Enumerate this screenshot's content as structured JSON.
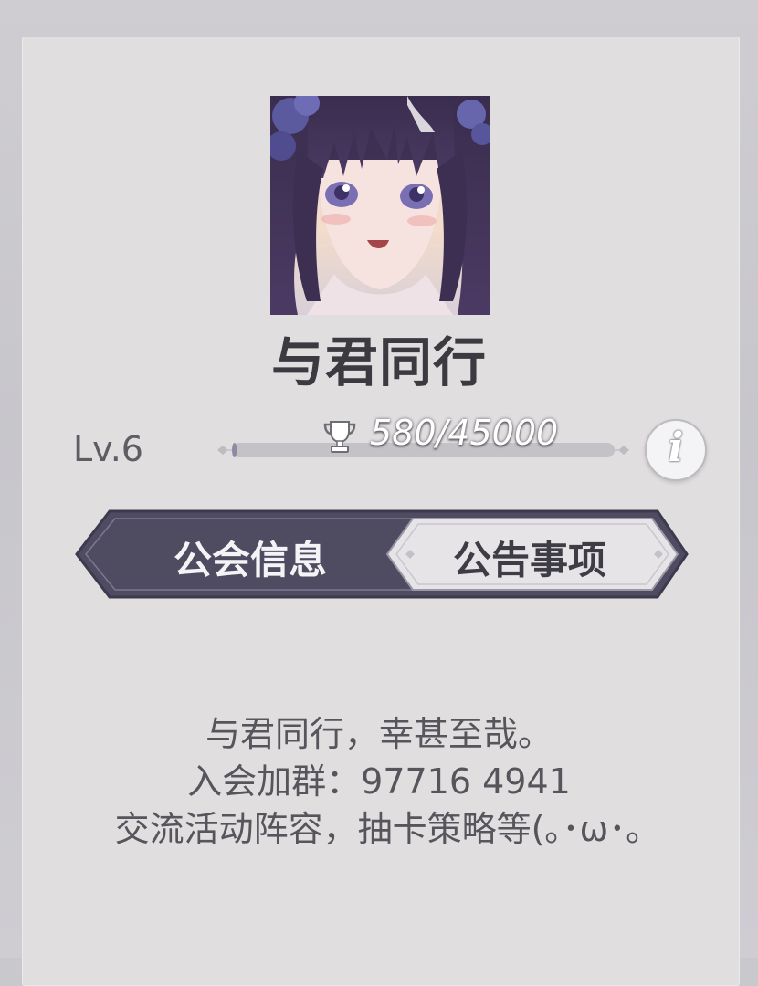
{
  "guild": {
    "name": "与君同行",
    "level": "Lv.6",
    "exp_text": "580/45000",
    "exp_progress": 0.0129
  },
  "icons": {
    "trophy": "trophy-icon",
    "info": "info-icon",
    "info_glyph": "i"
  },
  "tabs": [
    {
      "label": "公会信息",
      "selected": true
    },
    {
      "label": "公告事项",
      "selected": false
    }
  ],
  "notice": {
    "lines": [
      "与君同行，幸甚至哉。",
      "入会加群：97716 4941",
      "交流活动阵容，抽卡策略等(｡･ω･｡"
    ]
  },
  "colors": {
    "panel_bg": "#e1dedf",
    "tab_active_bg": "#4f4c62",
    "tab_inactive_bg": "#e6e4e6",
    "title_text": "#3c3a40"
  }
}
